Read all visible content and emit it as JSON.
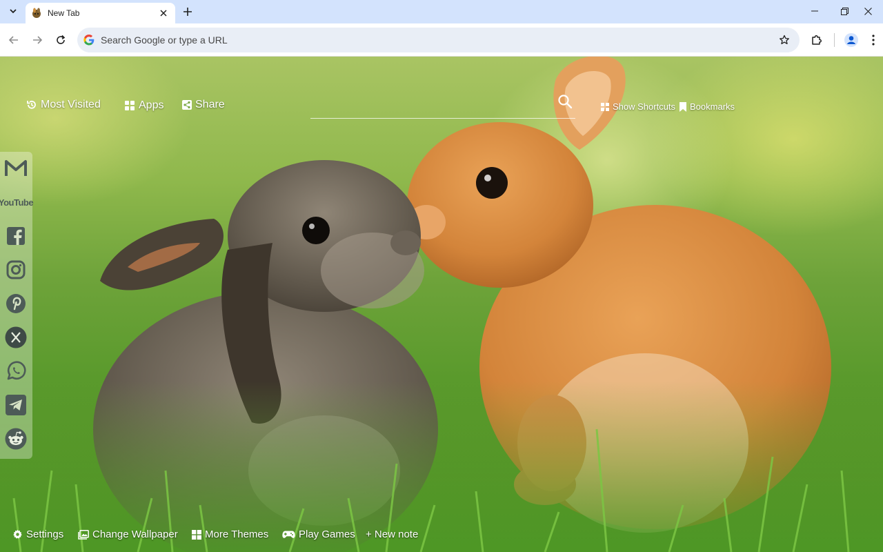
{
  "browser": {
    "tab": {
      "title": "New Tab",
      "favicon": "bunny-favicon"
    },
    "omnibox": {
      "placeholder": "Search Google or type a URL"
    }
  },
  "newtab": {
    "top_nav": {
      "most_visited": "Most Visited",
      "apps": "Apps",
      "share": "Share",
      "show_shortcuts": "Show Shortcuts",
      "bookmarks": "Bookmarks"
    },
    "social_links": [
      "gmail-icon",
      "youtube-icon",
      "facebook-icon",
      "instagram-icon",
      "pinterest-icon",
      "x-icon",
      "whatsapp-icon",
      "telegram-icon",
      "reddit-icon"
    ],
    "youtube_label": "YouTube",
    "bottom_bar": {
      "settings": "Settings",
      "change_wallpaper": "Change Wallpaper",
      "more_themes": "More Themes",
      "play_games": "Play Games",
      "new_note": "+ New note"
    }
  },
  "colors": {
    "tabstrip": "#d3e3fd",
    "omnibox": "#e9eef6",
    "accent": "#0b57d0"
  }
}
